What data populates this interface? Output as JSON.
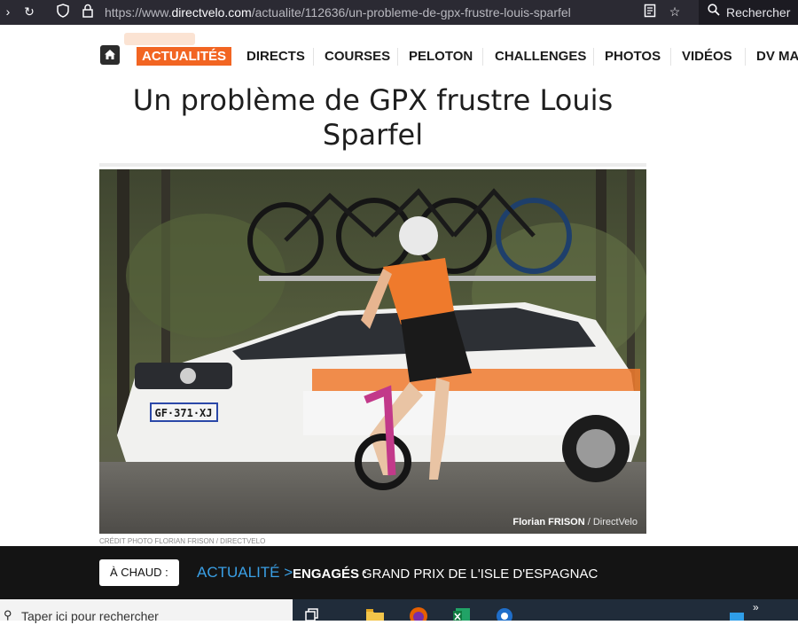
{
  "browser": {
    "url_prefix": "https://www.",
    "url_domain": "directvelo.com",
    "url_path": "/actualite/112636/un-probleme-de-gpx-frustre-louis-sparfel",
    "search_label": "Rechercher"
  },
  "nav": {
    "items": [
      {
        "label": "ACTUALITÉS",
        "active": true
      },
      {
        "label": "DIRECTS"
      },
      {
        "label": "COURSES"
      },
      {
        "label": "PELOTON"
      },
      {
        "label": "CHALLENGES"
      },
      {
        "label": "PHOTOS"
      },
      {
        "label": "VIDÉOS"
      },
      {
        "label": "DV MA"
      }
    ]
  },
  "article": {
    "title_line1": "Un problème de GPX frustre Louis",
    "title_line2": "Sparfel",
    "photo_caption_name": "Florian FRISON",
    "photo_caption_site": " / DirectVelo",
    "credit": "CRÉDIT PHOTO FLORIAN FRISON / DIRECTVELO"
  },
  "hot": {
    "label": "À CHAUD :",
    "section": "ACTUALITÉ >",
    "tag": "ENGAGÉS :",
    "headline": "GRAND PRIX DE L'ISLE D'ESPAGNAC"
  },
  "taskbar": {
    "search_placeholder": "Taper ici pour rechercher"
  },
  "colors": {
    "accent": "#f26522",
    "hot_section": "#3aa0e6"
  }
}
